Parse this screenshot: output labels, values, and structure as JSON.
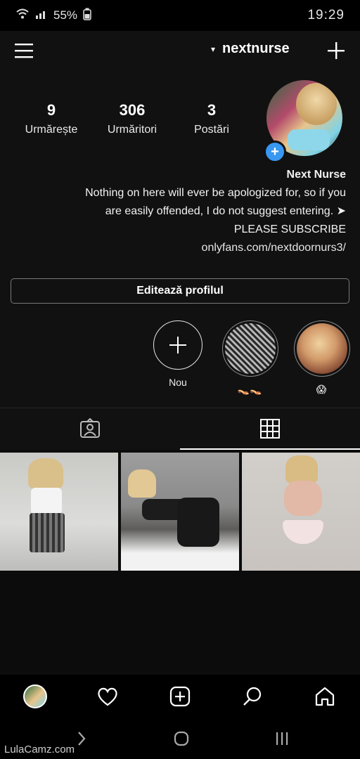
{
  "status_bar": {
    "battery": "55%",
    "time": "19:29"
  },
  "header": {
    "username": "nextnurse"
  },
  "profile": {
    "stats": [
      {
        "value": "3",
        "label": "Postări"
      },
      {
        "value": "306",
        "label": "Urmăritori"
      },
      {
        "value": "9",
        "label": "Urmărește"
      }
    ],
    "bio": {
      "name": "Next Nurse",
      "line1": "Nothing on here will ever be apologized for, so if you",
      "line2": "are easily offended, I do not suggest entering. ➤",
      "line3": "PLEASE SUBSCRIBE",
      "link": "onlyfans.com/nextdoornurs3/"
    },
    "edit_button": "Editează profilul"
  },
  "highlights": [
    {
      "label": "😱"
    },
    {
      "label": "👡👡"
    },
    {
      "label": "Nou"
    }
  ],
  "watermark": "LulaCamz.com",
  "colors": {
    "background": "#111111",
    "accent_blue": "#3897f0"
  }
}
